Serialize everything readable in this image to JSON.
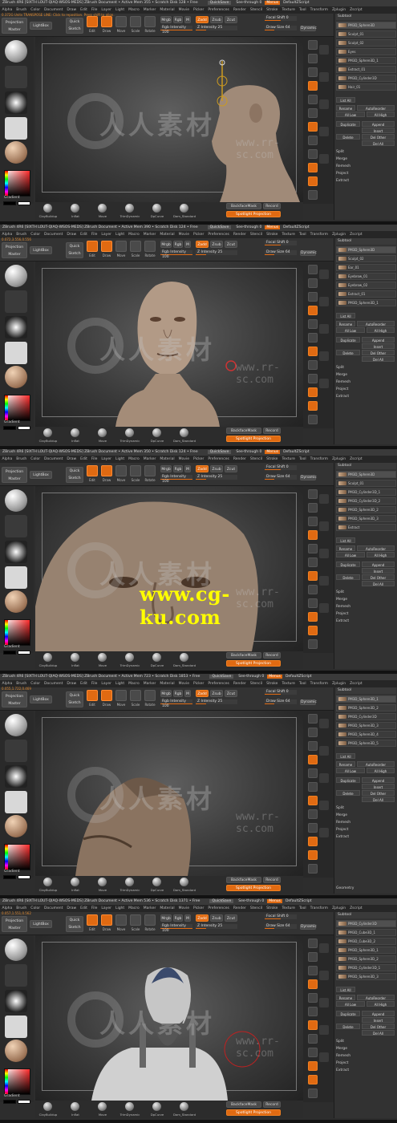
{
  "app": {
    "titles": [
      "ZBrush 4R6  [SIXTH LOUT-QIAQ-WSOS-MEDS]   ZBrush Document   • Active Mem 355 • Scratch Disk 128 • Free",
      "ZBrush 4R6  [SIXTH LOUT-QIAQ-WSOS-MEDS]   ZBrush Document   • Active Mem 390 • Scratch Disk 124 • Free",
      "ZBrush 4R6  [SIXTH LOUT-QIAQ-WSOS-MEDS]   ZBrush Document   • Active Mem 350 • Scratch Disk 124 • Free",
      "ZBrush 4R6  [SIXTH LOUT-QIAQ-WSOS-MEDS]   ZBrush Document   • Active Mem 723 • Scratch Disk 1853 • Free",
      "ZBrush 4R6  [SIXTH LOUT-QIAQ-WSOS-MEDS]   ZBrush Document   • Active Mem 536 • Scratch Disk 1371 • Free"
    ],
    "quicksave": "QuickSave",
    "seethrough": "See-through 0",
    "menus_btn": "Menus",
    "script": "DefaultZScript"
  },
  "menus": [
    "Alpha",
    "Brush",
    "Color",
    "Document",
    "Draw",
    "Edit",
    "File",
    "Layer",
    "Light",
    "Macro",
    "Marker",
    "Material",
    "Movie",
    "Picker",
    "Preferences",
    "Render",
    "Stencil",
    "Stroke",
    "Texture",
    "Tool",
    "Transform",
    "Zplugin",
    "Zscript"
  ],
  "status_lines": [
    "0.372G  Units   TRANSPOSE LINE: Click to reposition. Press shift to align.",
    "0.072,3.556,0.556",
    "",
    "0.055,1.722,0.469",
    "0.057,1.551,0.562"
  ],
  "toolbar": {
    "projection_master": "Projection Master",
    "lightbox": "LightBox",
    "quick_sketch": "Quick Sketch",
    "modes": [
      "Edit",
      "Draw",
      "Move",
      "Scale",
      "Rotate"
    ],
    "mrgb": "Mrgb",
    "rgb": "Rgb",
    "m": "M",
    "zadd": "Zadd",
    "zsub": "Zsub",
    "zcut": "Zcut",
    "rgb_intensity": "Rgb Intensity 100",
    "z_intensity": "Z Intensity 25",
    "focal_shift": "Focal Shift 0",
    "draw_size": "Draw Size 64",
    "dynamic": "Dynamic"
  },
  "left": {
    "gradient": "Gradient",
    "switch": "SwitchColor",
    "alternate": "Alternate"
  },
  "bottom": {
    "brushes": [
      "ClayBuildup",
      "Inflat",
      "Move",
      "TrimDynamic",
      "DpCurve",
      "Dam_Standard"
    ],
    "backface": "BackfaceMask",
    "record": "Record",
    "spotlight": "Spotlight Projection"
  },
  "right": {
    "labels": [
      "Bpr",
      "SPix 3",
      "Scroll",
      "Zoom",
      "Actual",
      "AAHalf",
      "Persp",
      "Floor",
      "Local",
      "LSym",
      "Frame",
      "Move",
      "Scale",
      "Rotate",
      "Line Fill",
      "Transp",
      "Solo",
      "Xpose"
    ]
  },
  "tray": {
    "head": "Subtool",
    "subtools": [
      [
        "PM3D_Sphere3D",
        "Sculpt_01",
        "Sculpt_02",
        "Eyes",
        "PM3D_Sphere3D_1",
        "Extract_01",
        "PM3D_Cylinder3D",
        "Hair_01"
      ],
      [
        "PM3D_Sphere3D",
        "Sculpt_02",
        "Ear_01",
        "Eyebrow_01",
        "Eyebrow_02",
        "Extract_01",
        "PM3D_Sphere3D_1"
      ],
      [
        "PM3D_Sphere3D",
        "Sculpt_01",
        "PM3D_Cylinder3D_1",
        "PM3D_Cylinder3D_2",
        "PM3D_Sphere3D_2",
        "PM3D_Sphere3D_3",
        "Extract"
      ],
      [
        "PM3D_Sphere3D_1",
        "PM3D_Sphere3D_2",
        "PM3D_Cylinder3D",
        "PM3D_Sphere3D_3",
        "PM3D_Sphere3D_4",
        "PM3D_Sphere3D_5"
      ],
      [
        "PM3D_Cylinder3D",
        "PM3D_Cube3D_1",
        "PM3D_Cube3D_2",
        "PM3D_Sphere3D_1",
        "PM3D_Sphere3D_2",
        "PM3D_Cylinder3D_1",
        "PM3D_Sphere3D_3"
      ]
    ],
    "list_all": "List All",
    "rename": "Rename",
    "autoreorder": "AutoReorder",
    "all_low": "All Low",
    "all_high": "All High",
    "duplicate": "Duplicate",
    "append": "Append",
    "insert": "Insert",
    "delete": "Delete",
    "del_other": "Del Other",
    "del_all": "Del All",
    "split": "Split",
    "merge": "Merge",
    "remesh": "Remesh",
    "project": "Project",
    "extract": "Extract",
    "geometry": "Geometry"
  },
  "watermark": {
    "cn": "人人素材",
    "url": "www.rr-sc.com",
    "cgku": "www.cg-ku.com"
  },
  "colors": {
    "accent": "#e06a12",
    "background": "#2d2d2d",
    "highlight": "#ffff00"
  }
}
